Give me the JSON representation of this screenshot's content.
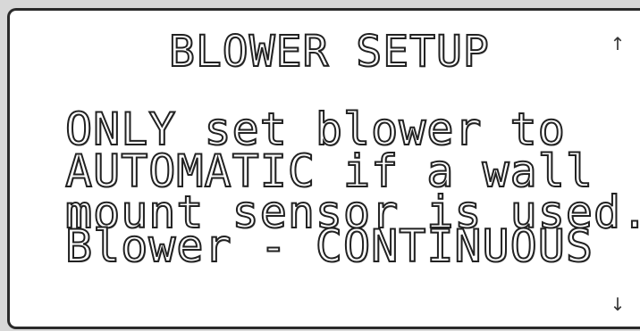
{
  "screen": {
    "title": "BLOWER SETUP",
    "lines": [
      "ONLY set blower to",
      "AUTOMATIC if a wall",
      "mount sensor is used.",
      "Blower - CONTINUOUS"
    ],
    "scroll_up_icon": "arrow-up",
    "scroll_down_icon": "arrow-down"
  }
}
